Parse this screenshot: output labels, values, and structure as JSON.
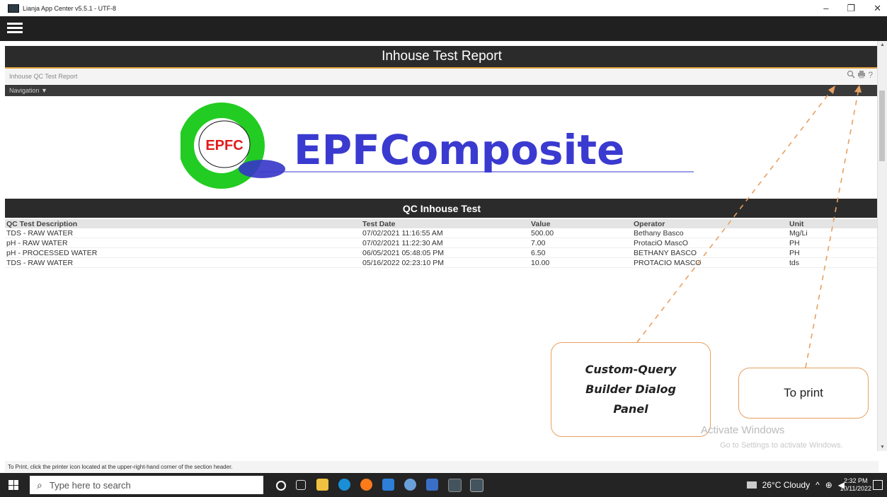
{
  "window": {
    "title": "Lianja App Center v5.5.1 - UTF-8",
    "controls": {
      "minimize": "–",
      "maximize": "❐",
      "close": "✕"
    }
  },
  "page": {
    "title": "Inhouse Test Report",
    "subheader_label": "Inhouse QC Test Report",
    "nav_label": "Navigation ▼",
    "icons": [
      "search-icon",
      "printer-icon",
      "help-icon"
    ]
  },
  "logo": {
    "badge": "EPFC",
    "wordmark": "EPFComposite"
  },
  "section": {
    "title": "QC Inhouse Test",
    "columns": [
      "QC Test Description",
      "Test Date",
      "Value",
      "Operator",
      "Unit"
    ],
    "rows": [
      [
        "TDS - RAW WATER",
        "07/02/2021 11:16:55 AM",
        "500.00",
        "Bethany Basco",
        "Mg/Li"
      ],
      [
        "pH - RAW WATER",
        "07/02/2021 11:22:30 AM",
        "7.00",
        "ProtaciO MascO",
        "PH"
      ],
      [
        "pH - PROCESSED WATER",
        "06/05/2021 05:48:05 PM",
        "6.50",
        "BETHANY BASCO",
        "PH"
      ],
      [
        "TDS - RAW WATER",
        "05/16/2022 02:23:10 PM",
        "10.00",
        "PROTACIO MASCO",
        "tds"
      ]
    ]
  },
  "annotations": {
    "query_callout": [
      "Custom-Query",
      "Builder Dialog",
      "Panel"
    ],
    "print_callout": "To print",
    "line_color": "#e8a060"
  },
  "watermark": {
    "line1": "Activate Windows",
    "line2": "Go to Settings to activate Windows."
  },
  "footer_hint": "To Print, click the printer icon located at the upper-right-hand corner of the section header.",
  "taskbar": {
    "search_placeholder": "Type here to search",
    "weather": "26°C  Cloudy",
    "time": "2:32 PM",
    "date": "10/11/2022"
  }
}
